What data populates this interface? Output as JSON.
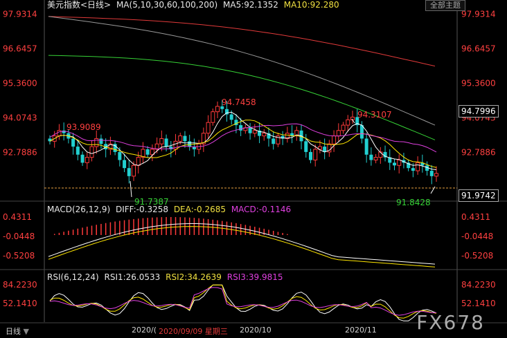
{
  "header": {
    "instrument": "美元指数<日线>",
    "ma_params": "MA(5,10,30,60,100,200)",
    "ma5": "MA5:92.1352",
    "ma10": "MA10:92.280",
    "toolbar_button": "全部主题"
  },
  "right_axis_main": [
    "97.9314",
    "96.6457",
    "95.3600",
    "94.0743",
    "92.7886"
  ],
  "left_axis_main": [
    "97.9314",
    "96.6457",
    "95.3600",
    "94.0743",
    "92.7886"
  ],
  "current_price_box": "94.7996",
  "last_price_box": "91.9742",
  "macd_header": {
    "params": "MACD(26,12,9)",
    "diff": "DIFF:-0.3258",
    "dea": "DEA:-0.2685",
    "macd": "MACD:-0.1146"
  },
  "macd_axis": [
    "0.4311",
    "-0.0448",
    "-0.5208"
  ],
  "rsi_header": {
    "params": "RSI(6,12,24)",
    "rsi1": "RSI1:26.0533",
    "rsi2": "RSI2:34.2639",
    "rsi3": "RSI3:39.9815"
  },
  "rsi_axis": [
    "84.2230",
    "52.1410"
  ],
  "footer": {
    "period": "日线",
    "date_cursor": "2020/09/09 星期三",
    "month1": "2020/(",
    "month2": "2020/10",
    "month3": "2020/11"
  },
  "watermark": "FX678",
  "colors": {
    "up": "#ff3a3a",
    "down": "#22cfd0",
    "ma5": "#ffffff",
    "ma10": "#ffe600",
    "ma30": "#e040e0",
    "ma60": "#36d236",
    "ma100": "#9a9a9a",
    "ma200": "#e23a3a"
  },
  "chart_data": {
    "type": "candlestick",
    "ylim": [
      91.2,
      98.0
    ],
    "annotations": [
      {
        "label": "93.9089",
        "value": 93.9089,
        "kind": "high"
      },
      {
        "label": "94.7458",
        "value": 94.7458,
        "kind": "high"
      },
      {
        "label": "94.3107",
        "value": 94.3107,
        "kind": "high"
      },
      {
        "label": "91.7387",
        "value": 91.7387,
        "kind": "low"
      },
      {
        "label": "91.8428",
        "value": 91.8428,
        "kind": "low"
      }
    ],
    "closes": [
      93.2,
      93.4,
      93.6,
      93.5,
      93.3,
      93.0,
      92.7,
      92.4,
      92.6,
      93.0,
      93.3,
      93.1,
      92.9,
      93.1,
      92.8,
      92.5,
      92.2,
      91.9,
      92.3,
      92.6,
      92.9,
      92.7,
      92.9,
      93.1,
      93.3,
      93.0,
      92.9,
      93.2,
      93.4,
      93.2,
      93.0,
      92.9,
      93.1,
      93.5,
      93.9,
      94.3,
      94.5,
      94.4,
      94.2,
      94.0,
      93.8,
      93.6,
      93.7,
      93.5,
      93.6,
      93.4,
      93.5,
      93.3,
      93.1,
      93.4,
      93.3,
      93.5,
      93.4,
      93.6,
      93.2,
      92.8,
      92.5,
      92.9,
      93.0,
      92.8,
      93.1,
      93.4,
      93.6,
      93.8,
      94.0,
      94.1,
      93.8,
      93.3,
      92.7,
      92.5,
      92.6,
      92.8,
      92.6,
      92.4,
      92.3,
      92.5,
      92.4,
      92.2,
      92.1,
      92.4,
      92.3,
      92.1,
      91.9,
      92.0
    ]
  }
}
